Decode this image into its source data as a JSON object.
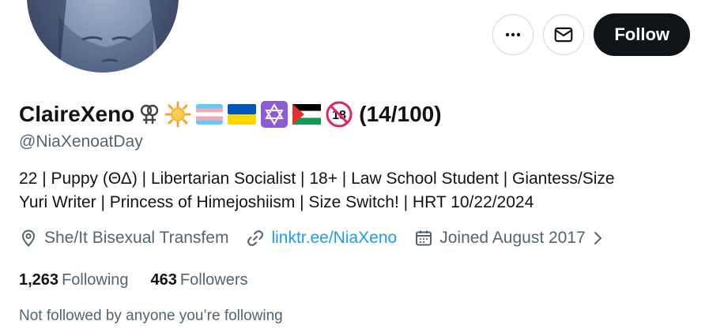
{
  "actions": {
    "more_icon": "more-icon",
    "message_icon": "mail-icon",
    "follow_label": "Follow"
  },
  "profile": {
    "display_name": "ClaireXeno",
    "emojis": [
      "sapphic-symbol",
      "sun",
      "trans-flag",
      "ukraine-flag",
      "star-of-david",
      "palestine-flag",
      "no-under-18"
    ],
    "count_label": "(14/100)",
    "handle": "@NiaXenoatDay",
    "bio_line1": "22 | Puppy (ΘΔ) | Libertarian Socialist | 18+ | Law School Student | Giantess/Size",
    "bio_line2": "Yuri Writer | Princess of Himejoshiism | Size Switch! | HRT 10/22/2024",
    "location": "She/It Bisexual Transfem",
    "link": "linktr.ee/NiaXeno",
    "joined": "Joined August 2017"
  },
  "stats": {
    "following_count": "1,263",
    "following_label": "Following",
    "followers_count": "463",
    "followers_label": "Followers"
  },
  "footer": {
    "not_followed": "Not followed by anyone you’re following"
  },
  "colors": {
    "text": "#0f1419",
    "secondary": "#536471",
    "link": "#1d9bf0",
    "button_dark": "#0f1419",
    "border": "#cfd9de"
  }
}
